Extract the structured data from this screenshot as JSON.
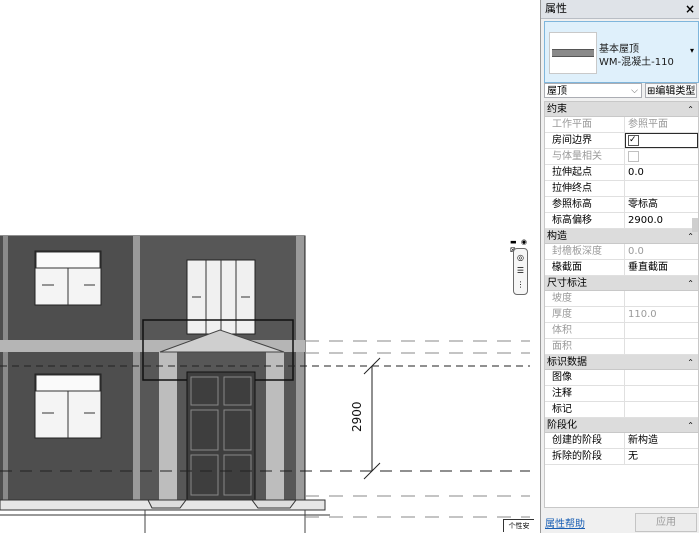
{
  "drawing": {
    "dimension_label": "2900",
    "bottom_tag": "个性安"
  },
  "nav_bar": {
    "top_icons": "▬ ◉ ⊠",
    "tools": [
      "◎",
      "☰",
      "⋮"
    ]
  },
  "properties": {
    "title": "属性",
    "close": "×",
    "type": {
      "family": "基本屋顶",
      "name": "WM-混凝土-110",
      "arrow": "▾"
    },
    "filter": {
      "value": "屋顶",
      "dropdown": "⌵",
      "edit_type_label": "编辑类型",
      "edit_type_icon": "⊞"
    },
    "groups": [
      {
        "label": "约束",
        "toggle": "⌃",
        "rows": [
          {
            "key": "工作平面",
            "value": "参照平面",
            "disabled": true
          },
          {
            "key": "房间边界",
            "checkbox": "on",
            "boxed": true
          },
          {
            "key": "与体量相关",
            "checkbox": "off",
            "disabled": true
          },
          {
            "key": "拉伸起点",
            "value": "0.0"
          },
          {
            "key": "拉伸终点",
            "value": ""
          },
          {
            "key": "参照标高",
            "value": "零标高"
          },
          {
            "key": "标高偏移",
            "value": "2900.0"
          }
        ]
      },
      {
        "label": "构造",
        "toggle": "⌃",
        "rows": [
          {
            "key": "封檐板深度",
            "value": "0.0",
            "disabled": true
          },
          {
            "key": "椽截面",
            "value": "垂直截面"
          }
        ]
      },
      {
        "label": "尺寸标注",
        "toggle": "⌃",
        "rows": [
          {
            "key": "坡度",
            "value": "",
            "disabled": true
          },
          {
            "key": "厚度",
            "value": "110.0",
            "disabled": true
          },
          {
            "key": "体积",
            "value": "",
            "disabled": true
          },
          {
            "key": "面积",
            "value": "",
            "disabled": true
          }
        ]
      },
      {
        "label": "标识数据",
        "toggle": "⌃",
        "rows": [
          {
            "key": "图像",
            "value": ""
          },
          {
            "key": "注释",
            "value": ""
          },
          {
            "key": "标记",
            "value": ""
          }
        ]
      },
      {
        "label": "阶段化",
        "toggle": "⌃",
        "rows": [
          {
            "key": "创建的阶段",
            "value": "新构造"
          },
          {
            "key": "拆除的阶段",
            "value": "无"
          }
        ]
      }
    ],
    "help_link": "属性帮助",
    "apply_button": "应用"
  }
}
